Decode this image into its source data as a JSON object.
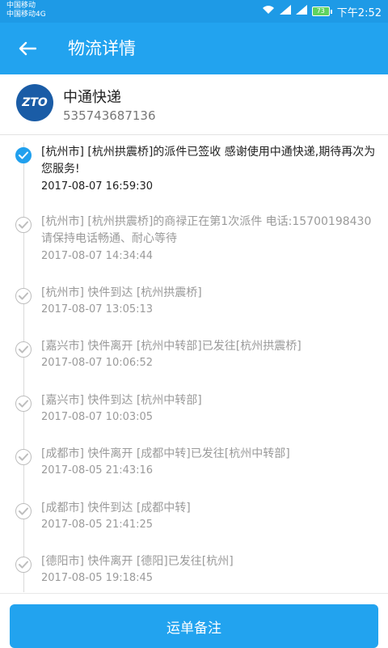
{
  "status_bar": {
    "carrier1": "中国移动",
    "carrier2": "中国移动4G",
    "battery": "73",
    "time": "下午2:52"
  },
  "header": {
    "title": "物流详情"
  },
  "company": {
    "logo_text": "ZTO",
    "name": "中通快递",
    "tracking_number": "535743687136"
  },
  "events": [
    {
      "desc": "[杭州市] [杭州拱震桥]的派件已签收 感谢使用中通快递,期待再次为您服务!",
      "time": "2017-08-07 16:59:30",
      "active": true
    },
    {
      "desc": "[杭州市] [杭州拱震桥]的商禄正在第1次派件 电话:15700198430 请保持电话畅通、耐心等待",
      "time": "2017-08-07 14:34:44",
      "active": false
    },
    {
      "desc": "[杭州市] 快件到达 [杭州拱震桥]",
      "time": "2017-08-07 13:05:13",
      "active": false
    },
    {
      "desc": "[嘉兴市] 快件离开 [杭州中转部]已发往[杭州拱震桥]",
      "time": "2017-08-07 10:06:52",
      "active": false
    },
    {
      "desc": "[嘉兴市] 快件到达 [杭州中转部]",
      "time": "2017-08-07 10:03:05",
      "active": false
    },
    {
      "desc": "[成都市] 快件离开 [成都中转]已发往[杭州中转部]",
      "time": "2017-08-05 21:43:16",
      "active": false
    },
    {
      "desc": "[成都市] 快件到达 [成都中转]",
      "time": "2017-08-05 21:41:25",
      "active": false
    },
    {
      "desc": "[德阳市] 快件离开 [德阳]已发往[杭州]",
      "time": "2017-08-05 19:18:45",
      "active": false
    }
  ],
  "footer": {
    "remark_button": "运单备注"
  }
}
